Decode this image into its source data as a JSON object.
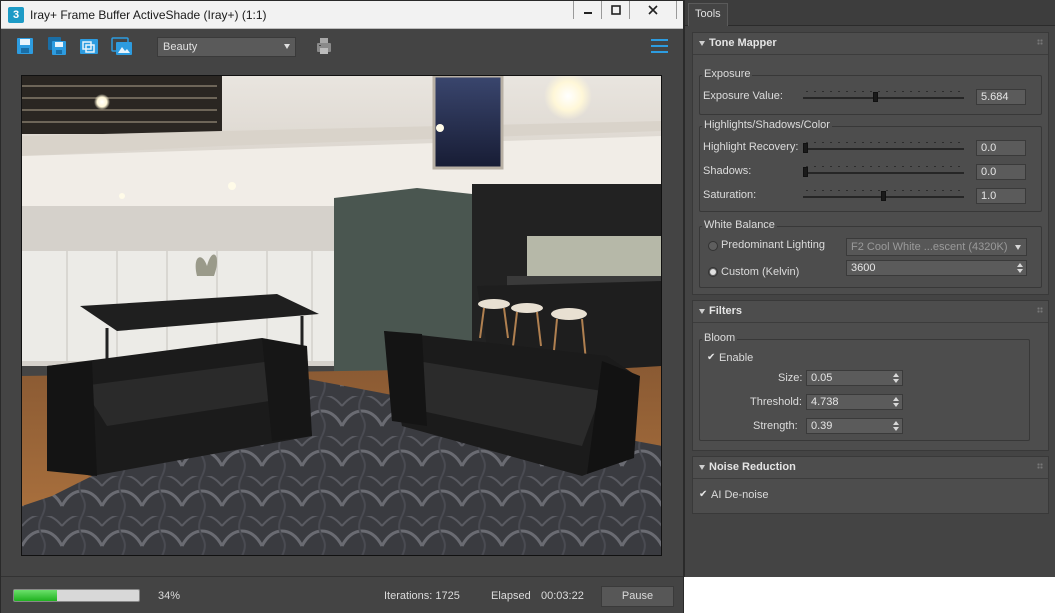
{
  "window": {
    "app_icon_label": "3",
    "title": "Iray+ Frame Buffer  ActiveShade  (Iray+) (1:1)",
    "minimize_glyph": "▁",
    "maximize_glyph": "□",
    "close_glyph": "✕"
  },
  "toolbar": {
    "icons": [
      "save-icon",
      "save-all-icon",
      "copy-icon",
      "clone-window-icon",
      "print-icon",
      "menu-icon"
    ],
    "channel_selected": "Beauty",
    "accent_color": "#2d9ce0"
  },
  "status": {
    "progress_percent": 34,
    "progress_label": "34%",
    "iterations_label": "Iterations: 1725",
    "elapsed_label": "Elapsed",
    "elapsed_value": "00:03:22",
    "pause_label": "Pause"
  },
  "tools": {
    "tab_label": "Tools",
    "tone_mapper": {
      "title": "Tone Mapper",
      "exposure_group": "Exposure",
      "exposure_value_label": "Exposure Value:",
      "exposure_value": "5.684",
      "exposure_slider_fraction": 0.45,
      "hsc_group": "Highlights/Shadows/Color",
      "highlight_label": "Highlight Recovery:",
      "highlight_value": "0.0",
      "highlight_slider_fraction": 0.0,
      "shadows_label": "Shadows:",
      "shadows_value": "0.0",
      "shadows_slider_fraction": 0.0,
      "saturation_label": "Saturation:",
      "saturation_value": "1.0",
      "saturation_slider_fraction": 0.5,
      "white_balance_group": "White Balance",
      "predominant_label": "Predominant Lighting",
      "predominant_value": "F2 Cool White ...escent (4320K)",
      "custom_label": "Custom (Kelvin)",
      "custom_value": "3600"
    },
    "filters": {
      "title": "Filters",
      "bloom_group": "Bloom",
      "enable_label": "Enable",
      "enable_check": "✔",
      "size_label": "Size:",
      "size_value": "0.05",
      "threshold_label": "Threshold:",
      "threshold_value": "4.738",
      "strength_label": "Strength:",
      "strength_value": "0.39"
    },
    "noise_reduction": {
      "title": "Noise Reduction",
      "ai_denoise_label": "AI De-noise",
      "ai_denoise_check": "✔"
    }
  }
}
